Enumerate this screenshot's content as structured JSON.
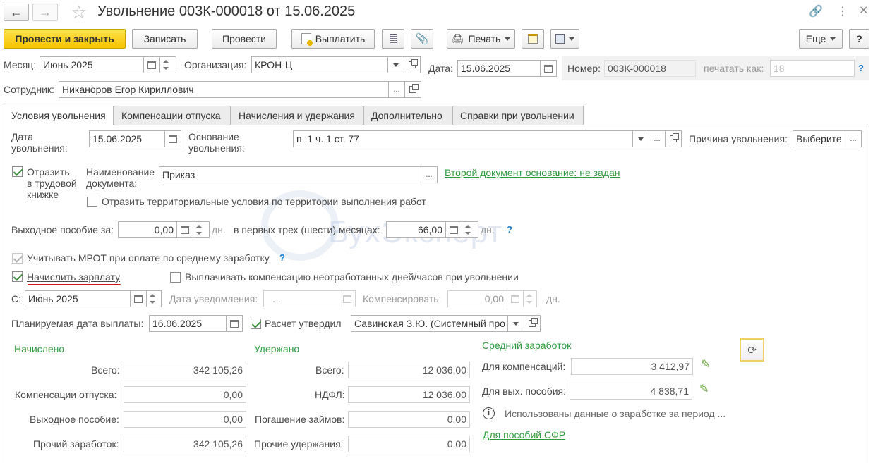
{
  "window": {
    "title": "Увольнение 003К-000018 от 15.06.2025",
    "accent": "#f5c400",
    "green": "#2f9a3f"
  },
  "toolbar": {
    "post_close": "Провести и закрыть",
    "save": "Записать",
    "post": "Провести",
    "pay": "Выплатить",
    "print": "Печать",
    "more": "Еще",
    "help": "?"
  },
  "header": {
    "month_label": "Месяц:",
    "month_value": "Июнь 2025",
    "org_label": "Организация:",
    "org_value": "КРОН-Ц",
    "date_label": "Дата:",
    "date_value": "15.06.2025",
    "number_label": "Номер:",
    "number_value": "003К-000018",
    "print_as_label": "печатать как:",
    "print_as_value": "18",
    "employee_label": "Сотрудник:",
    "employee_value": "Никаноров Егор Кириллович"
  },
  "tabs": [
    {
      "label": "Условия увольнения"
    },
    {
      "label": "Компенсации отпуска"
    },
    {
      "label": "Начисления и удержания"
    },
    {
      "label": "Дополнительно"
    },
    {
      "label": "Справки при увольнении"
    }
  ],
  "conditions": {
    "dismissal_date_label": "Дата увольнения:",
    "dismissal_date_label_line1": "Дата",
    "dismissal_date_label_line2": "увольнения:",
    "dismissal_date_value": "15.06.2025",
    "basis_label_line1": "Основание",
    "basis_label_line2": "увольнения:",
    "basis_value": "п. 1 ч. 1 ст. 77",
    "reason_label": "Причина увольнения:",
    "reason_value": "Выберите",
    "workbook_line1": "Отразить",
    "workbook_line2": "в трудовой",
    "workbook_line3": "книжке",
    "doc_name_line1": "Наименование",
    "doc_name_line2": "документа:",
    "doc_name_value": "Приказ",
    "second_doc_link": "Второй документ основание: не задан",
    "territorial_label": "Отразить территориальные условия по территории выполнения работ",
    "severance_label": "Выходное пособие за:",
    "severance_value": "0,00",
    "days_unit": "дн.",
    "first_months_label": "в первых трех (шести) месяцах:",
    "first_months_value": "66,00",
    "mrot_label": "Учитывать МРОТ при оплате по среднему заработку",
    "accrue_salary_label": "Начислить зарплату",
    "pay_comp_label": "Выплачивать компенсацию неотработанных дней/часов при увольнении",
    "from_label": "С:",
    "from_value": "Июнь 2025",
    "notice_date_label": "Дата уведомления:",
    "notice_date_value": ". .",
    "compensate_label": "Компенсировать:",
    "compensate_value": "0,00",
    "planned_pay_label": "Планируемая дата выплаты:",
    "planned_pay_value": "16.06.2025",
    "approved_label": "Расчет утвердил",
    "approved_value": "Савинская З.Ю. (Системный про"
  },
  "accrued": {
    "title": "Начислено",
    "rows": [
      {
        "label": "Всего:",
        "value": "342 105,26"
      },
      {
        "label": "Компенсации отпуска:",
        "value": "0,00"
      },
      {
        "label": "Выходное пособие:",
        "value": "0,00"
      },
      {
        "label": "Прочий заработок:",
        "value": "342 105,26"
      }
    ]
  },
  "withheld": {
    "title": "Удержано",
    "rows": [
      {
        "label": "Всего:",
        "value": "12 036,00"
      },
      {
        "label": "НДФЛ:",
        "value": "12 036,00"
      },
      {
        "label": "Погашение займов:",
        "value": "0,00"
      },
      {
        "label": "Прочие удержания:",
        "value": "0,00"
      }
    ]
  },
  "average": {
    "title": "Средний заработок",
    "comp_label": "Для компенсаций:",
    "comp_value": "3 412,97",
    "sev_label": "Для вых. пособия:",
    "sev_value": "4 838,71",
    "info_text": "Использованы данные о заработке за период ...",
    "sfr_link": "Для пособий СФР"
  },
  "watermark": "БухЭксперт"
}
